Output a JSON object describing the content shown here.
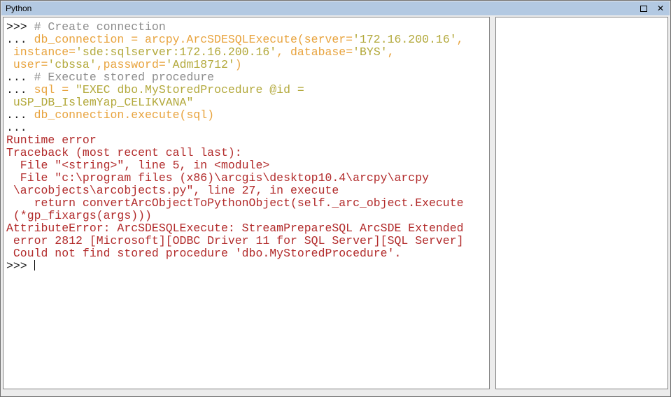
{
  "window": {
    "title": "Python",
    "controls": {
      "maximize_icon": "square-outline",
      "close_glyph": "✕"
    }
  },
  "palette": {
    "titlebar": "#b3c9e2",
    "prompt": "#1c1c1c",
    "comment": "#8c8c8c",
    "code": "#e8a33d",
    "string": "#b3a93c",
    "error": "#b22b2b"
  },
  "console": {
    "lines": [
      {
        "segments": [
          {
            "t": ">>> ",
            "c": "prompt"
          },
          {
            "t": "# Create connection",
            "c": "comment"
          }
        ]
      },
      {
        "segments": [
          {
            "t": "... ",
            "c": "prompt"
          },
          {
            "t": "db_connection = arcpy.ArcSDESQLExecute(server=",
            "c": "code"
          },
          {
            "t": "'172.16.200.16'",
            "c": "string"
          },
          {
            "t": ",",
            "c": "code"
          }
        ]
      },
      {
        "segments": [
          {
            "t": " instance=",
            "c": "code"
          },
          {
            "t": "'sde:sqlserver:172.16.200.16'",
            "c": "string"
          },
          {
            "t": ", database=",
            "c": "code"
          },
          {
            "t": "'BYS'",
            "c": "string"
          },
          {
            "t": ",",
            "c": "code"
          }
        ]
      },
      {
        "segments": [
          {
            "t": " user=",
            "c": "code"
          },
          {
            "t": "'cbssa'",
            "c": "string"
          },
          {
            "t": ",password=",
            "c": "code"
          },
          {
            "t": "'Adm18712'",
            "c": "string"
          },
          {
            "t": ")",
            "c": "code"
          }
        ]
      },
      {
        "segments": [
          {
            "t": "... ",
            "c": "prompt"
          },
          {
            "t": "# Execute stored procedure",
            "c": "comment"
          }
        ]
      },
      {
        "segments": [
          {
            "t": "... ",
            "c": "prompt"
          },
          {
            "t": "sql = ",
            "c": "code"
          },
          {
            "t": "\"EXEC dbo.MyStoredProcedure @id =",
            "c": "string"
          }
        ]
      },
      {
        "segments": [
          {
            "t": " uSP_DB_IslemYap_CELIKVANA\"",
            "c": "string"
          }
        ]
      },
      {
        "segments": [
          {
            "t": "... ",
            "c": "prompt"
          },
          {
            "t": "db_connection.execute(sql)",
            "c": "code"
          }
        ]
      },
      {
        "segments": [
          {
            "t": "...",
            "c": "prompt"
          }
        ]
      },
      {
        "segments": [
          {
            "t": "Runtime error",
            "c": "error"
          }
        ]
      },
      {
        "segments": [
          {
            "t": "Traceback (most recent call last):",
            "c": "error"
          }
        ]
      },
      {
        "segments": [
          {
            "t": "  File \"<string>\", line 5, in <module>",
            "c": "error"
          }
        ]
      },
      {
        "segments": [
          {
            "t": "  File \"c:\\program files (x86)\\arcgis\\desktop10.4\\arcpy\\arcpy",
            "c": "error"
          }
        ]
      },
      {
        "segments": [
          {
            "t": " \\arcobjects\\arcobjects.py\", line 27, in execute",
            "c": "error"
          }
        ]
      },
      {
        "segments": [
          {
            "t": "    return convertArcObjectToPythonObject(self._arc_object.Execute",
            "c": "error"
          }
        ]
      },
      {
        "segments": [
          {
            "t": " (*gp_fixargs(args)))",
            "c": "error"
          }
        ]
      },
      {
        "segments": [
          {
            "t": "AttributeError: ArcSDESQLExecute: StreamPrepareSQL ArcSDE Extended",
            "c": "error"
          }
        ]
      },
      {
        "segments": [
          {
            "t": " error 2812 [Microsoft][ODBC Driver 11 for SQL Server][SQL Server]",
            "c": "error"
          }
        ]
      },
      {
        "segments": [
          {
            "t": " Could not find stored procedure 'dbo.MyStoredProcedure'.",
            "c": "error"
          }
        ]
      },
      {
        "segments": [
          {
            "t": ">>> ",
            "c": "prompt"
          }
        ],
        "cursor": true
      }
    ]
  }
}
